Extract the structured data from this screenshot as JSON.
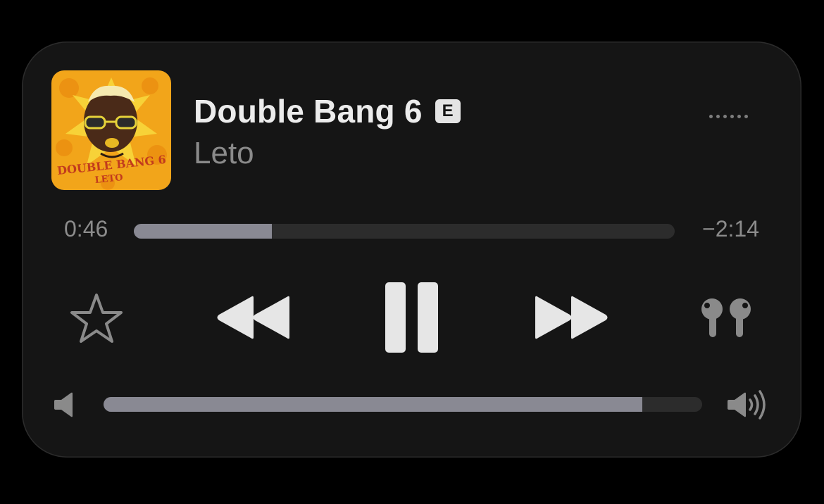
{
  "now_playing": {
    "title": "Double Bang 6",
    "explicit_badge": "E",
    "artist": "Leto",
    "artwork": {
      "text_line1": "DOUBLE BANG 6",
      "text_line2": "LETO",
      "background_color": "#f2a51a"
    }
  },
  "menu": {
    "icon": "more-dots-icon"
  },
  "progress": {
    "elapsed": "0:46",
    "remaining": "−2:14",
    "fraction": 0.255
  },
  "controls": {
    "favorite_icon": "star-icon",
    "rewind_icon": "rewind-icon",
    "pause_icon": "pause-icon",
    "forward_icon": "fast-forward-icon",
    "output_icon": "airpods-icon"
  },
  "volume": {
    "level": 0.9,
    "min_icon": "speaker-low-icon",
    "max_icon": "speaker-high-icon"
  },
  "colors": {
    "card_background": "#151515",
    "track": "#2c2c2c",
    "fill": "#898993",
    "control_primary": "#e6e6e6",
    "control_secondary": "#8a8a8a"
  }
}
